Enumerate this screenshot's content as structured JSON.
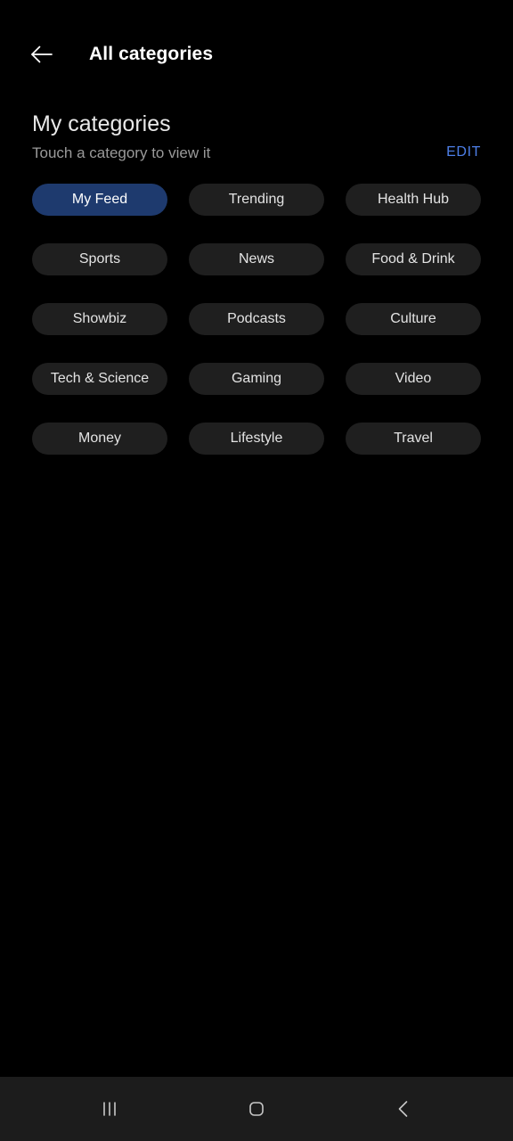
{
  "appbar": {
    "back_icon": "arrow-left-icon",
    "title": "All categories"
  },
  "section": {
    "title": "My categories",
    "subtitle": "Touch a category to view it",
    "edit_label": "EDIT"
  },
  "categories": [
    {
      "label": "My Feed",
      "selected": true
    },
    {
      "label": "Trending",
      "selected": false
    },
    {
      "label": "Health Hub",
      "selected": false
    },
    {
      "label": "Sports",
      "selected": false
    },
    {
      "label": "News",
      "selected": false
    },
    {
      "label": "Food & Drink",
      "selected": false
    },
    {
      "label": "Showbiz",
      "selected": false
    },
    {
      "label": "Podcasts",
      "selected": false
    },
    {
      "label": "Culture",
      "selected": false
    },
    {
      "label": "Tech & Science",
      "selected": false
    },
    {
      "label": "Gaming",
      "selected": false
    },
    {
      "label": "Video",
      "selected": false
    },
    {
      "label": "Money",
      "selected": false
    },
    {
      "label": "Lifestyle",
      "selected": false
    },
    {
      "label": "Travel",
      "selected": false
    }
  ],
  "navbar": {
    "recents_icon": "recents-icon",
    "home_icon": "home-icon",
    "back_icon": "back-chevron-icon"
  },
  "colors": {
    "background": "#000000",
    "chip": "#1f1f1f",
    "chip_selected": "#1e3a6e",
    "accent_link": "#4d7fe8",
    "navbar": "#1c1c1c",
    "text_primary": "#ffffff",
    "text_secondary": "#9a9a9a"
  }
}
